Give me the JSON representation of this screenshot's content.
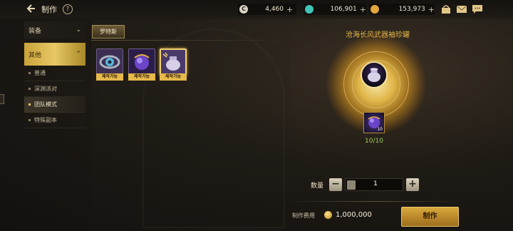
{
  "header": {
    "title": "制作",
    "help_label": "?",
    "currencies": [
      {
        "icon": "c-coin-icon",
        "value": "4,460",
        "plus": "+"
      },
      {
        "icon": "gem-icon",
        "value": "106,901",
        "plus": "+"
      },
      {
        "icon": "gold-icon",
        "value": "153,973",
        "plus": "+"
      }
    ]
  },
  "sidebar": {
    "categories": [
      {
        "label": "装备",
        "state": "collapsed"
      },
      {
        "label": "其他",
        "state": "expanded"
      }
    ],
    "items": [
      {
        "label": "普通",
        "active": false
      },
      {
        "label": "深渊派对",
        "active": false
      },
      {
        "label": "团队模式",
        "active": true
      },
      {
        "label": "特殊副本",
        "active": false
      }
    ]
  },
  "center": {
    "character_tab": "罗特斯",
    "items": [
      {
        "badge": "제작가능",
        "icon": "mechanical-device-icon"
      },
      {
        "badge": "제작가능",
        "icon": "purple-orb-icon"
      },
      {
        "badge": "제작가능",
        "icon": "pot-icon",
        "selected": true
      }
    ]
  },
  "detail": {
    "result_name": "沧海长风武器袖珍罐",
    "material_count": "10",
    "material_progress": "10/10",
    "quantity_label": "数量",
    "quantity_minus": "−",
    "quantity_plus": "+",
    "quantity_value": "1",
    "cost_label": "制作费用",
    "cost_value": "1,000,000",
    "craft_button": "制作"
  },
  "colors": {
    "accent_gold": "#e8c865",
    "progress_green": "#9fd45a",
    "title_orange": "#e7b84a"
  }
}
